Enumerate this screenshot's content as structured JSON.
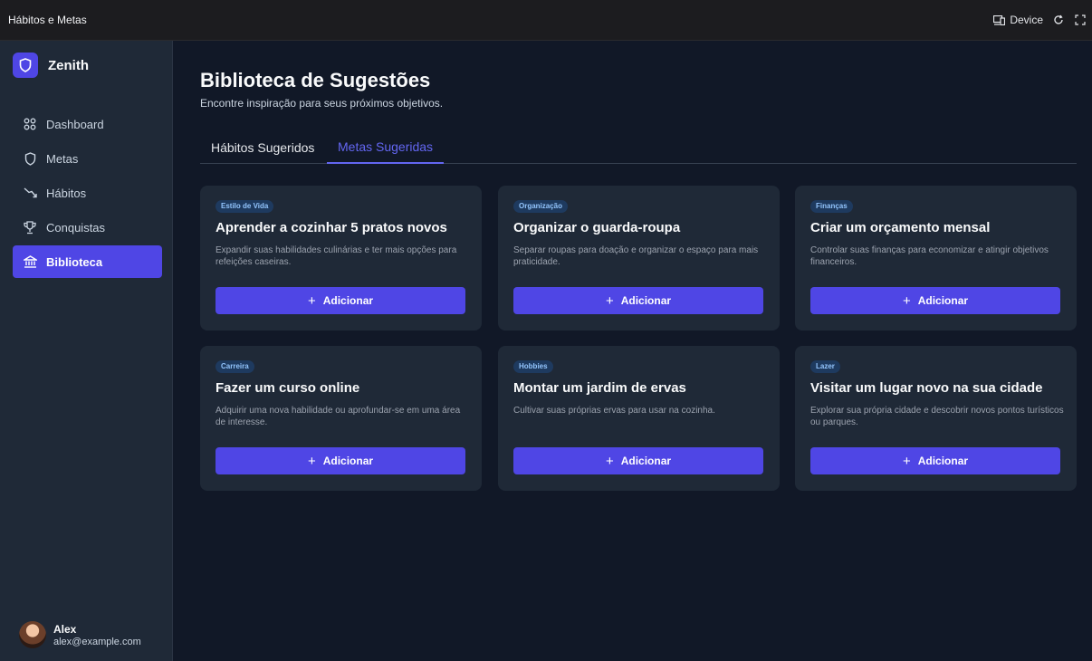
{
  "window": {
    "title": "Hábitos e Metas",
    "device_label": "Device",
    "icons": [
      "device-icon",
      "refresh-icon",
      "expand-icon"
    ]
  },
  "sidebar": {
    "brand": "Zenith",
    "items": [
      {
        "label": "Dashboard",
        "icon": "dashboard-icon",
        "active": false
      },
      {
        "label": "Metas",
        "icon": "shield-icon",
        "active": false
      },
      {
        "label": "Hábitos",
        "icon": "trend-icon",
        "active": false
      },
      {
        "label": "Conquistas",
        "icon": "trophy-icon",
        "active": false
      },
      {
        "label": "Biblioteca",
        "icon": "library-icon",
        "active": true
      }
    ],
    "user": {
      "name": "Alex",
      "email": "alex@example.com"
    }
  },
  "main": {
    "title": "Biblioteca de Sugestões",
    "subtitle": "Encontre inspiração para seus próximos objetivos.",
    "tabs": [
      {
        "label": "Hábitos Sugeridos",
        "active": false
      },
      {
        "label": "Metas Sugeridas",
        "active": true
      }
    ],
    "cards": [
      {
        "category": "Estilo de Vida",
        "title": "Aprender a cozinhar 5 pratos novos",
        "description": "Expandir suas habilidades culinárias e ter mais opções para refeições caseiras.",
        "button": "Adicionar"
      },
      {
        "category": "Organização",
        "title": "Organizar o guarda-roupa",
        "description": "Separar roupas para doação e organizar o espaço para mais praticidade.",
        "button": "Adicionar"
      },
      {
        "category": "Finanças",
        "title": "Criar um orçamento mensal",
        "description": "Controlar suas finanças para economizar e atingir objetivos financeiros.",
        "button": "Adicionar"
      },
      {
        "category": "Carreira",
        "title": "Fazer um curso online",
        "description": "Adquirir uma nova habilidade ou aprofundar-se em uma área de interesse.",
        "button": "Adicionar"
      },
      {
        "category": "Hobbies",
        "title": "Montar um jardim de ervas",
        "description": "Cultivar suas próprias ervas para usar na cozinha.",
        "button": "Adicionar"
      },
      {
        "category": "Lazer",
        "title": "Visitar um lugar novo na sua cidade",
        "description": "Explorar sua própria cidade e descobrir novos pontos turísticos ou parques.",
        "button": "Adicionar"
      }
    ]
  },
  "colors": {
    "accent": "#4f46e5",
    "accent_text": "#6366f1",
    "background": "#111827",
    "surface": "#1f2937",
    "badge_bg": "#1e3a5f",
    "badge_text": "#93c5fd"
  }
}
